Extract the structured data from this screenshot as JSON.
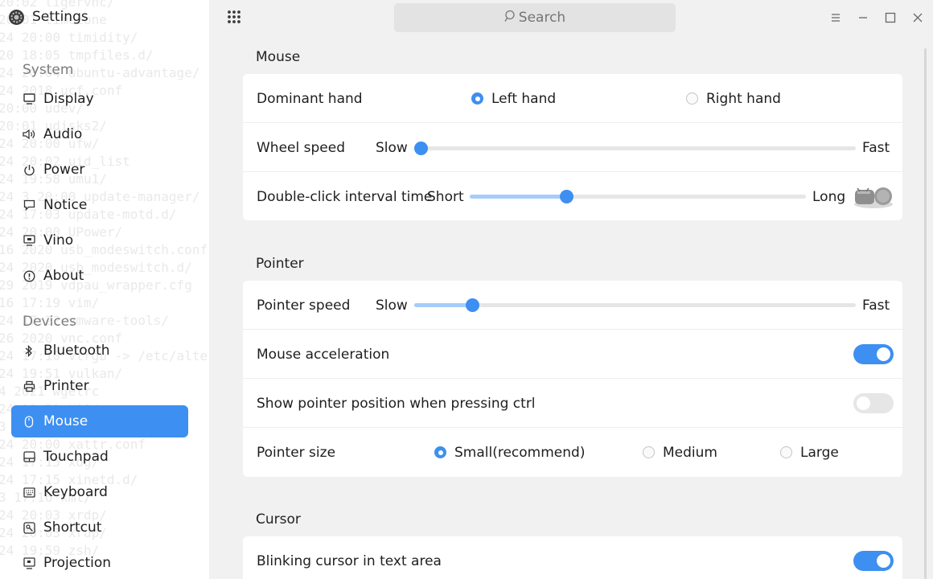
{
  "app": {
    "title": "Settings",
    "icon": "gear-icon"
  },
  "background_terminal": [
    "20:02 tigervnc/",
    "20:01 timezone",
    "24 20:00 timidity/",
    "20 18:05 tmpfiles.d/",
    "24 20:04 ubuntu-advantage/",
    "24 2018 ucf.conf",
    "20:00 udev/",
    "20:01 udisks2/",
    "24 20:00 ufw/",
    "24 20:02 uid_list",
    "24 19:58 umu1/",
    "24 3 20:00 update-manager/",
    "24 17:03 update-motd.d/",
    "24 20:00 UPower/",
    "16 2020 usb_modeswitch.conf",
    "24 2020 usb_modeswitch.d/",
    "29 2019 vdpau_wrapper.cfg",
    "16 17:19 vim/",
    "24 17:22 vmware-tools/",
    "26 2020 vnc.conf",
    "24 17:10 vtrgb -> /etc/alternatives",
    "24 19:51 vulkan/",
    "4 2021 wgetrc",
    "24 19:51 X11/",
    "3 17:06 x11/",
    "24 20:00 xattr.conf",
    "24 17:15 xdg/",
    "24 17:15 xinetd.d/",
    "3 17:16 xml/",
    "24 20:03 xrdp/",
    "24 20:03 xrdp/",
    "24 19:59 zsh/"
  ],
  "sidebar": {
    "sections": [
      {
        "title": "System"
      },
      {
        "title": "Devices"
      }
    ],
    "items": [
      {
        "label": "Display",
        "icon": "monitor-icon"
      },
      {
        "label": "Audio",
        "icon": "speaker-icon"
      },
      {
        "label": "Power",
        "icon": "power-icon"
      },
      {
        "label": "Notice",
        "icon": "notice-icon"
      },
      {
        "label": "Vino",
        "icon": "remote-desktop-icon"
      },
      {
        "label": "About",
        "icon": "info-icon"
      },
      {
        "label": "Bluetooth",
        "icon": "bluetooth-icon"
      },
      {
        "label": "Printer",
        "icon": "printer-icon"
      },
      {
        "label": "Mouse",
        "icon": "mouse-icon",
        "active": true
      },
      {
        "label": "Touchpad",
        "icon": "touchpad-icon"
      },
      {
        "label": "Keyboard",
        "icon": "keyboard-icon"
      },
      {
        "label": "Shortcut",
        "icon": "shortcut-icon"
      },
      {
        "label": "Projection",
        "icon": "projection-icon"
      }
    ]
  },
  "topbar": {
    "search_placeholder": "Search",
    "icons": [
      "app-grid-icon",
      "search-icon",
      "menu-icon",
      "minimize-icon",
      "maximize-icon",
      "close-icon"
    ]
  },
  "mouse": {
    "title": "Mouse",
    "dominant_hand": {
      "label": "Dominant hand",
      "options": [
        "Left hand",
        "Right hand"
      ],
      "selected": "Left hand"
    },
    "wheel_speed": {
      "label": "Wheel speed",
      "min_label": "Slow",
      "max_label": "Fast",
      "value": 0.0
    },
    "double_click": {
      "label": "Double-click interval time",
      "min_label": "Short",
      "max_label": "Long",
      "value": 0.28
    }
  },
  "pointer": {
    "title": "Pointer",
    "pointer_speed": {
      "label": "Pointer speed",
      "min_label": "Slow",
      "max_label": "Fast",
      "value": 0.12
    },
    "mouse_acceleration": {
      "label": "Mouse acceleration",
      "on": true
    },
    "show_position": {
      "label": "Show pointer position when pressing ctrl",
      "on": false
    },
    "pointer_size": {
      "label": "Pointer size",
      "options": [
        "Small(recommend)",
        "Medium",
        "Large"
      ],
      "selected": "Small(recommend)"
    }
  },
  "cursor": {
    "title": "Cursor",
    "blinking": {
      "label": "Blinking cursor in text area",
      "on": true
    }
  },
  "colors": {
    "accent": "#3d8ff1",
    "accent_light": "#a6cdfa",
    "sidebar_bg": "#ffffff",
    "content_bg": "#f1f1f1"
  }
}
